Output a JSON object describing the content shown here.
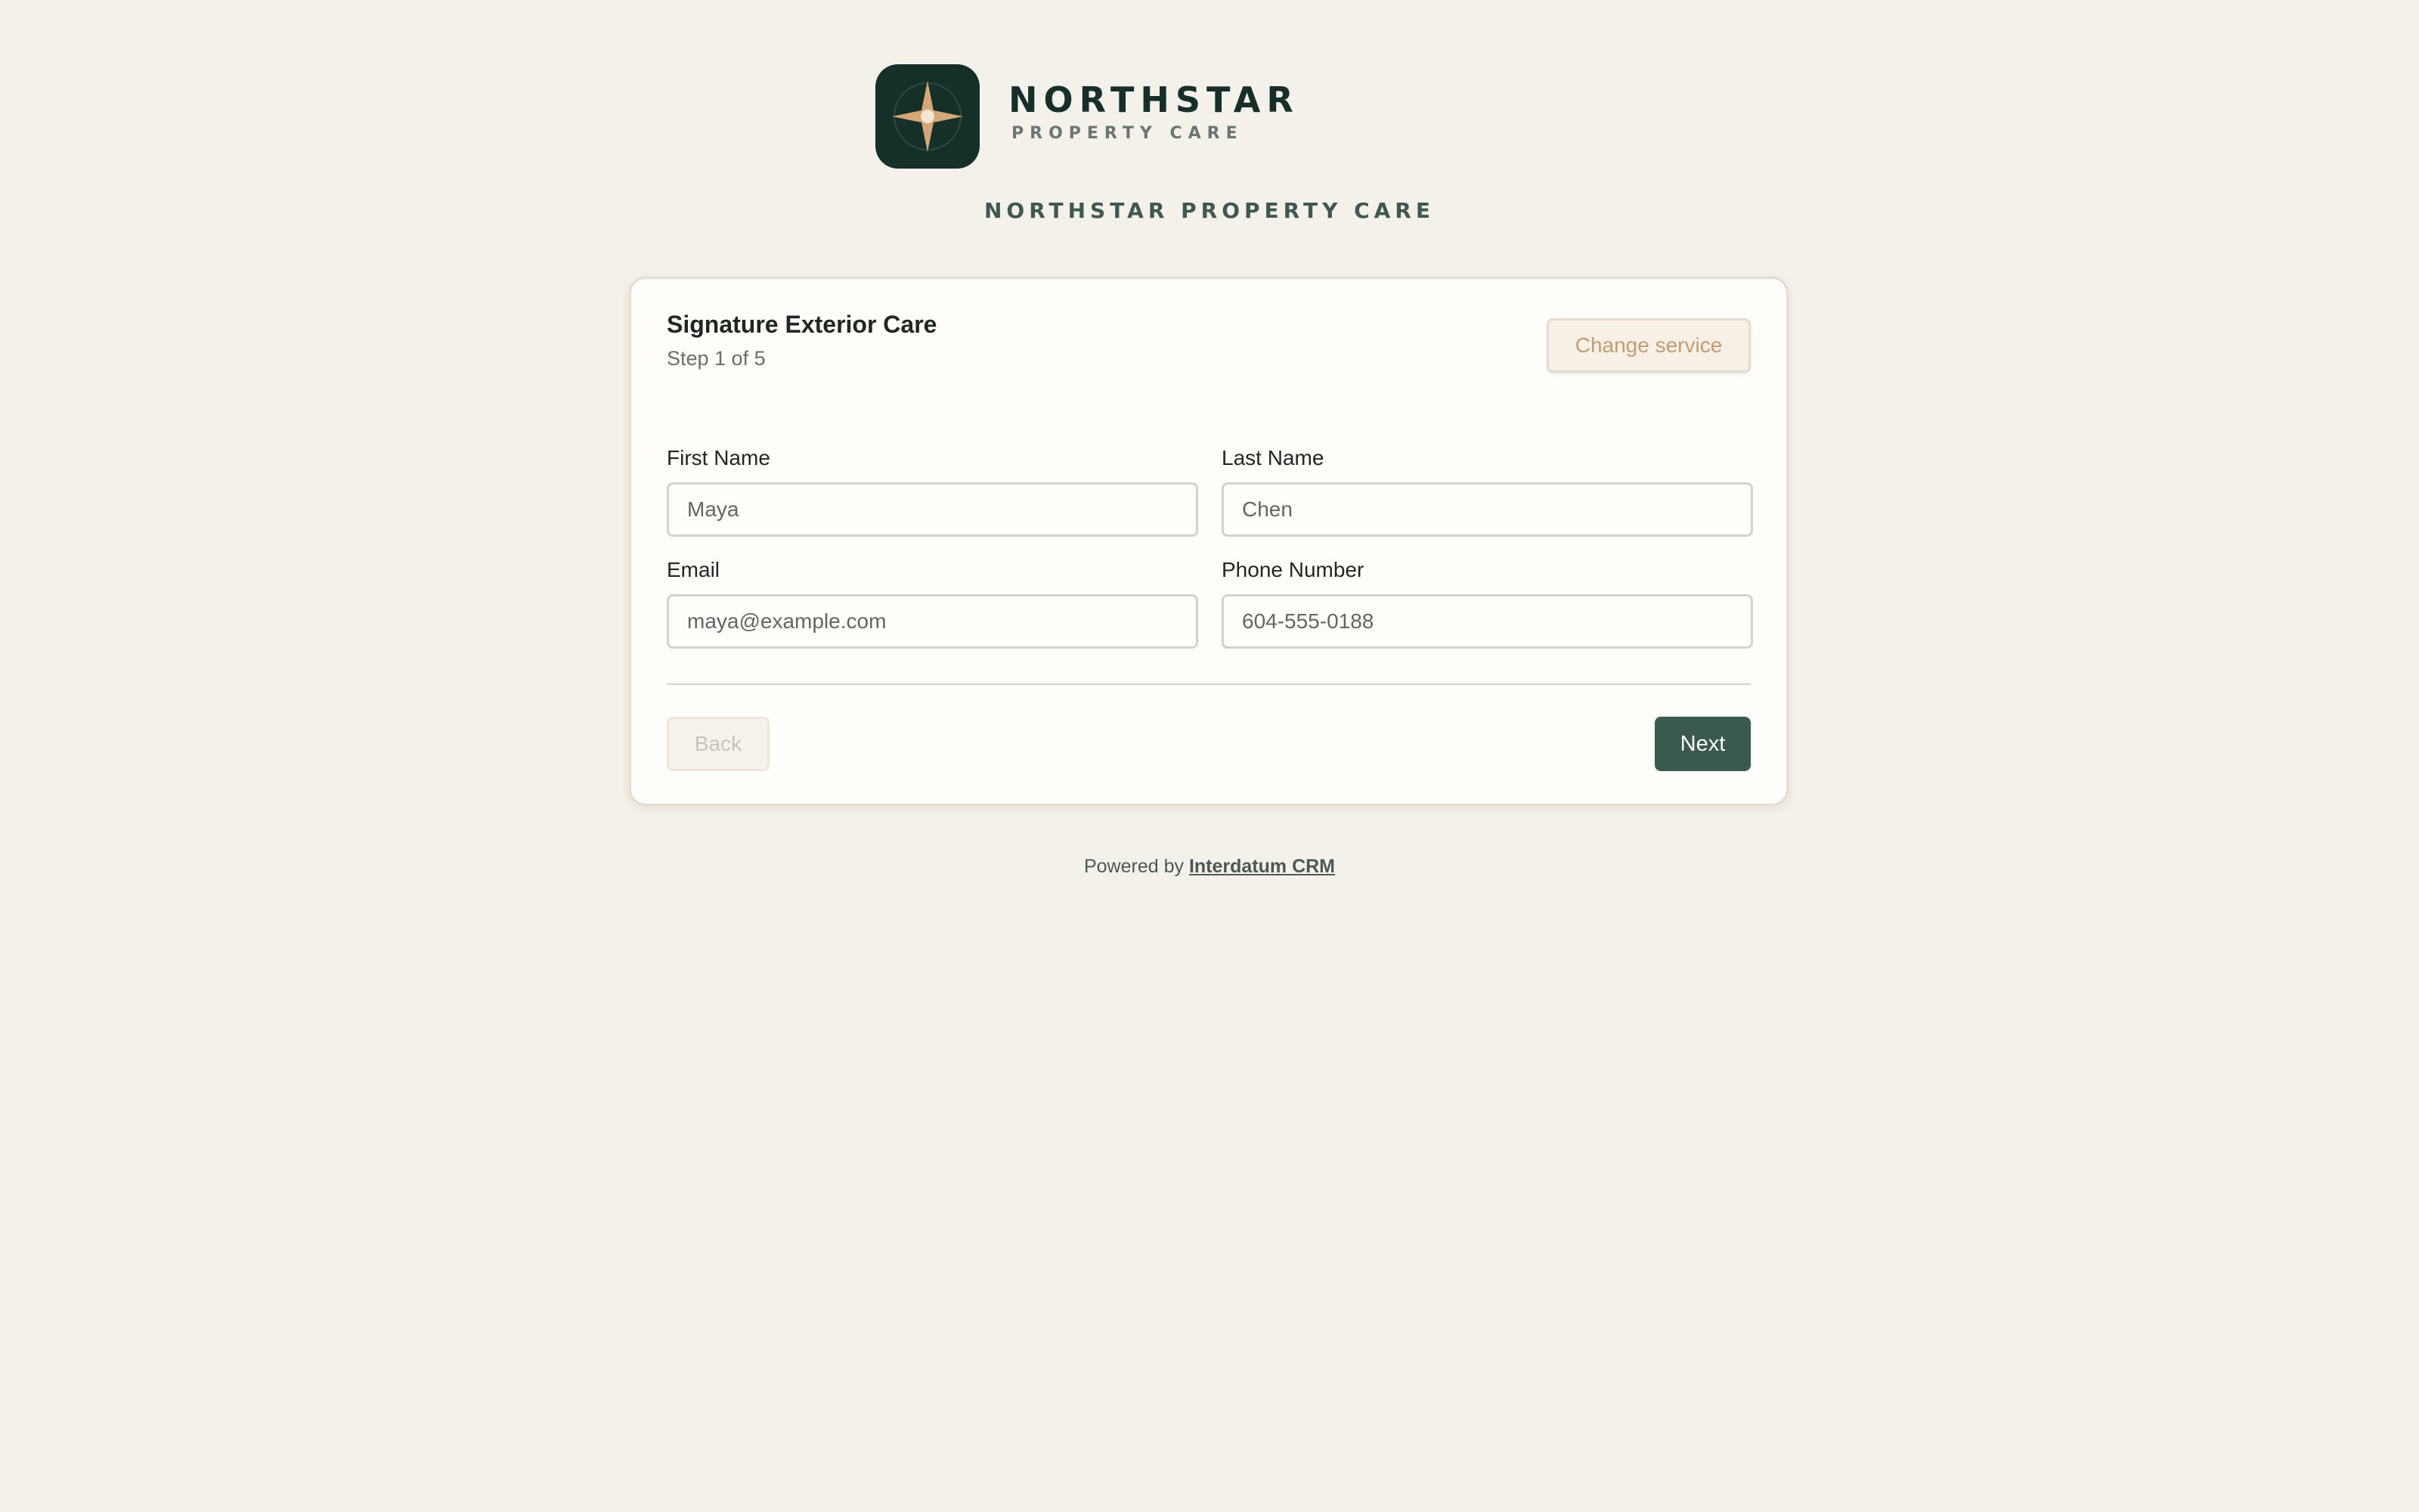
{
  "brand": {
    "logo_icon": "compass-star-icon",
    "name": "NORTHSTAR",
    "subtitle": "PROPERTY CARE",
    "tagline": "NORTHSTAR PROPERTY CARE",
    "colors": {
      "background": "#f4f0ea",
      "logo_bg": "#143028",
      "accent_gold": "#d6a775",
      "primary_green": "#3a5a4e"
    }
  },
  "form": {
    "service_title": "Signature Exterior Care",
    "step_label": "Step 1 of 5",
    "change_service_label": "Change service",
    "fields": {
      "first_name": {
        "label": "First Name",
        "value": "Maya",
        "placeholder": ""
      },
      "last_name": {
        "label": "Last Name",
        "value": "Chen",
        "placeholder": ""
      },
      "email": {
        "label": "Email",
        "value": "maya@example.com",
        "placeholder": ""
      },
      "phone": {
        "label": "Phone Number",
        "value": "604-555-0188",
        "placeholder": ""
      }
    },
    "back_label": "Back",
    "next_label": "Next"
  },
  "footer": {
    "powered_by": "Powered by",
    "link_text": "Interdatum CRM"
  }
}
